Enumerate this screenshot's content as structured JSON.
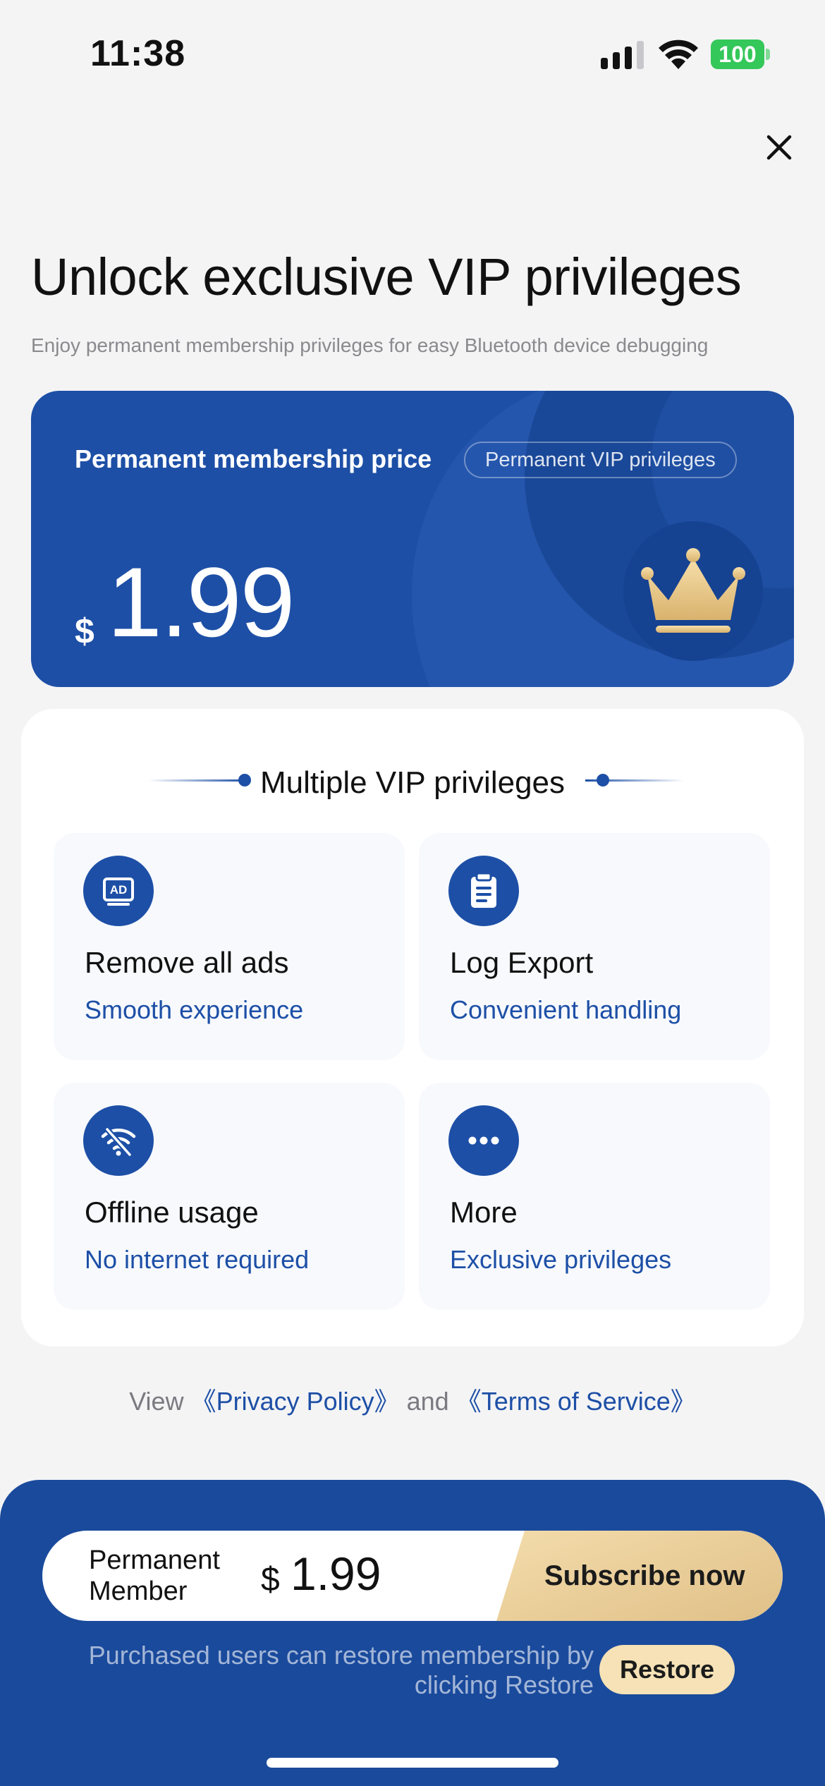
{
  "status_bar": {
    "time": "11:38",
    "battery": "100"
  },
  "header": {
    "title": "Unlock exclusive VIP privileges",
    "subtitle": "Enjoy permanent membership privileges for easy Bluetooth device debugging"
  },
  "price_card": {
    "label": "Permanent membership price",
    "badge": "Permanent VIP privileges",
    "currency": "$",
    "price": "1.99",
    "icon": "crown-icon"
  },
  "privileges": {
    "title": "Multiple VIP privileges",
    "items": [
      {
        "icon": "ad-icon",
        "title": "Remove all ads",
        "subtitle": "Smooth experience"
      },
      {
        "icon": "clipboard-icon",
        "title": "Log Export",
        "subtitle": "Convenient handling"
      },
      {
        "icon": "wifi-off-icon",
        "title": "Offline usage",
        "subtitle": "No internet required"
      },
      {
        "icon": "more-icon",
        "title": "More",
        "subtitle": "Exclusive privileges"
      }
    ]
  },
  "policy": {
    "prefix": "View ",
    "privacy": "《Privacy Policy》",
    "conjunction": " and ",
    "terms": "《Terms of Service》"
  },
  "purchase": {
    "plan_label": "Permanent Member",
    "currency": "$",
    "price": "1.99",
    "subscribe_label": "Subscribe now",
    "restore_note": "Purchased users can restore membership by clicking Restore",
    "restore_label": "Restore"
  },
  "colors": {
    "brand_blue": "#1d4fa6",
    "panel_blue": "#1a4a9c",
    "gold": "#e8c98f",
    "battery_green": "#34c759"
  }
}
